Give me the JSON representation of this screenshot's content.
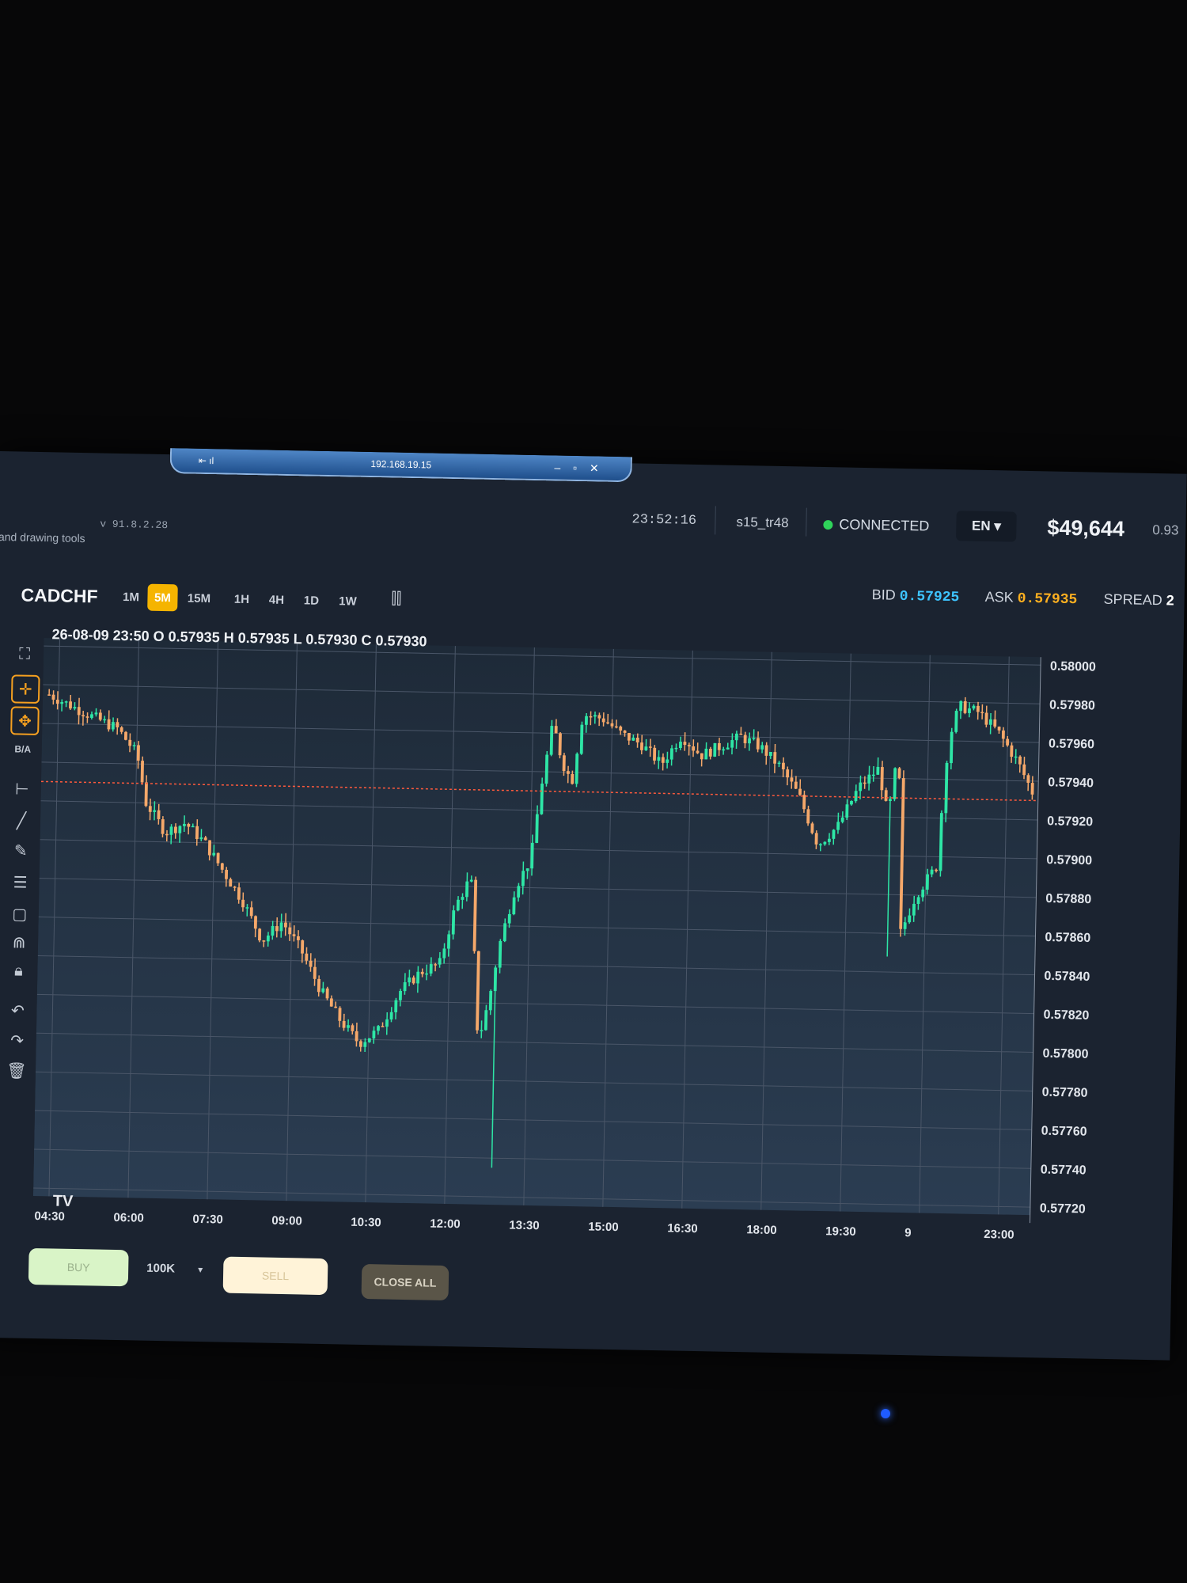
{
  "window": {
    "remote_host": "192.168.19.15",
    "remote_pin": "⇤ ıl",
    "remote_controls": "– ▫ ✕"
  },
  "header": {
    "tools_hint": "and drawing tools",
    "version": "v 91.8.2.28",
    "clock": "23:52:16",
    "user": "s15_tr48",
    "status": "CONNECTED",
    "language": "EN ▾",
    "balance": "$49,644",
    "balance_secondary": "0.93"
  },
  "symbol_bar": {
    "symbol": "CADCHF",
    "timeframes": [
      "1M",
      "5M",
      "15M",
      "1H",
      "4H",
      "1D",
      "1W"
    ],
    "active_timeframe": "5M",
    "bid_label": "BID",
    "bid": "0.57925",
    "ask_label": "ASK",
    "ask": "0.57935",
    "spread_label": "SPREAD",
    "spread": "2"
  },
  "toolbar": {
    "icons": [
      "fullscreen-icon",
      "crosshair-icon",
      "move-icon",
      "bid-ask-toggle",
      "horizontal-line-icon",
      "trend-line-icon",
      "pencil-icon",
      "fib-levels-icon",
      "rectangle-icon",
      "magnet-icon",
      "lock-icon",
      "undo-icon",
      "redo-icon",
      "trash-icon"
    ],
    "bid_ask_label": "B/A"
  },
  "ohlc_line": "26-08-09 23:50 O 0.57935 H 0.57935 L 0.57930 C 0.57930",
  "tv_logo": "TV",
  "colors": {
    "up": "#2ee6a6",
    "down": "#f5a86a",
    "price_line": "#ff5a3c",
    "grid": "#4a5668",
    "chart_bg_top": "#1e2a38",
    "chart_bg_bottom": "#2b3d52"
  },
  "chart_data": {
    "type": "candlestick",
    "x_ticks": [
      "04:30",
      "06:00",
      "07:30",
      "09:00",
      "10:30",
      "12:00",
      "13:30",
      "15:00",
      "16:30",
      "18:00",
      "19:30",
      "9",
      "23:00"
    ],
    "y_ticks": [
      "0.58000",
      "0.57980",
      "0.57960",
      "0.57940",
      "0.57920",
      "0.57900",
      "0.57880",
      "0.57860",
      "0.57840",
      "0.57820",
      "0.57800",
      "0.57780",
      "0.57760",
      "0.57740",
      "0.57720"
    ],
    "ylim": [
      0.5772,
      0.58
    ],
    "current_price": 0.5793,
    "close_path": [
      [
        0,
        0.57975
      ],
      [
        8,
        0.57965
      ],
      [
        14,
        0.57958
      ],
      [
        18,
        0.57945
      ],
      [
        20,
        0.5792
      ],
      [
        24,
        0.57905
      ],
      [
        28,
        0.5791
      ],
      [
        32,
        0.579
      ],
      [
        36,
        0.57885
      ],
      [
        40,
        0.5787
      ],
      [
        44,
        0.5785
      ],
      [
        48,
        0.5786
      ],
      [
        52,
        0.57845
      ],
      [
        56,
        0.57825
      ],
      [
        60,
        0.5781
      ],
      [
        64,
        0.57798
      ],
      [
        68,
        0.57805
      ],
      [
        72,
        0.57825
      ],
      [
        76,
        0.57835
      ],
      [
        80,
        0.5784
      ],
      [
        83,
        0.5787
      ],
      [
        86,
        0.57885
      ],
      [
        88,
        0.578
      ],
      [
        90,
        0.5782
      ],
      [
        92,
        0.5785
      ],
      [
        95,
        0.5788
      ],
      [
        98,
        0.57895
      ],
      [
        100,
        0.57935
      ],
      [
        102,
        0.57965
      ],
      [
        104,
        0.57945
      ],
      [
        106,
        0.57935
      ],
      [
        108,
        0.5797
      ],
      [
        112,
        0.57968
      ],
      [
        116,
        0.5796
      ],
      [
        120,
        0.57955
      ],
      [
        124,
        0.57945
      ],
      [
        128,
        0.5796
      ],
      [
        132,
        0.5795
      ],
      [
        136,
        0.57955
      ],
      [
        140,
        0.5796
      ],
      [
        144,
        0.57955
      ],
      [
        148,
        0.57945
      ],
      [
        152,
        0.5793
      ],
      [
        156,
        0.57905
      ],
      [
        160,
        0.57915
      ],
      [
        164,
        0.57935
      ],
      [
        168,
        0.57945
      ],
      [
        170,
        0.5792
      ],
      [
        172,
        0.57955
      ],
      [
        173,
        0.5786
      ],
      [
        176,
        0.5788
      ],
      [
        180,
        0.57895
      ],
      [
        182,
        0.5796
      ],
      [
        184,
        0.57978
      ],
      [
        188,
        0.57975
      ],
      [
        192,
        0.57965
      ],
      [
        196,
        0.5795
      ],
      [
        200,
        0.5793
      ]
    ]
  },
  "trade_bar": {
    "buy": "BUY",
    "lot": "100K",
    "lot_caret": "▾",
    "sell": "SELL",
    "close_all": "CLOSE ALL"
  }
}
